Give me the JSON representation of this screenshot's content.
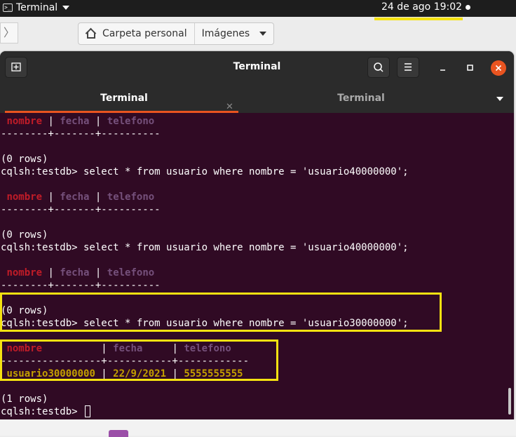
{
  "topbar": {
    "app_name": "Terminal",
    "clock": "24 de ago  19:02",
    "accent": "#f5e211"
  },
  "file_manager": {
    "breadcrumbs": [
      "Carpeta personal",
      "Imágenes"
    ]
  },
  "window": {
    "title": "Terminal",
    "tabs": [
      {
        "label": "Terminal",
        "active": true
      },
      {
        "label": "Terminal",
        "active": false
      }
    ],
    "icons": {
      "new_tab": "new-tab-icon",
      "search": "search-icon",
      "menu": "hamburger-icon",
      "minimize": "minimize-icon",
      "maximize": "maximize-icon",
      "close": "close-icon"
    },
    "accent": "#e95420"
  },
  "terminal": {
    "background": "#300a24",
    "header_columns": [
      "nombre",
      "fecha",
      "telefono"
    ],
    "rule_short": "--------+-------+----------",
    "zero_rows": "(0 rows)",
    "query_4": "cqlsh:testdb> select * from usuario where nombre = 'usuario40000000';",
    "query_3": "cqlsh:testdb> select * from usuario where nombre = 'usuario30000000';",
    "result_header_nombre": "nombre          ",
    "result_header_fecha": " fecha     ",
    "result_header_telefono": " telefono",
    "result_rule": "-----------------+-----------+------------",
    "result_row": {
      "nombre": "usuario30000000",
      "fecha": "22/9/2021",
      "telefono": "5555555555"
    },
    "one_row": "(1 rows)",
    "prompt": "cqlsh:testdb> "
  }
}
